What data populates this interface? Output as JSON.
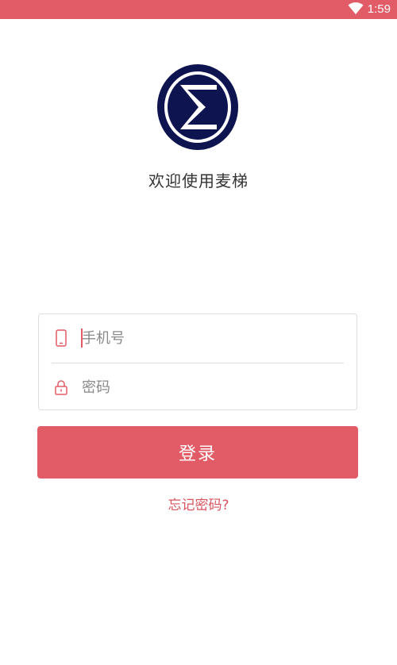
{
  "status_bar": {
    "time": "1:59",
    "icon": "wifi-icon",
    "color": "#e25c67"
  },
  "logo": {
    "icon": "sigma-logo-icon"
  },
  "welcome_text": "欢迎使用麦梯",
  "login_form": {
    "phone": {
      "icon": "phone-icon",
      "placeholder": "手机号",
      "value": ""
    },
    "password": {
      "icon": "lock-icon",
      "placeholder": "密码",
      "value": ""
    }
  },
  "login_button": {
    "label": "登录"
  },
  "forgot_password": {
    "label": "忘记密码?"
  },
  "colors": {
    "accent": "#e25c67",
    "logo_navy": "#0d1450",
    "border": "#dedede"
  }
}
